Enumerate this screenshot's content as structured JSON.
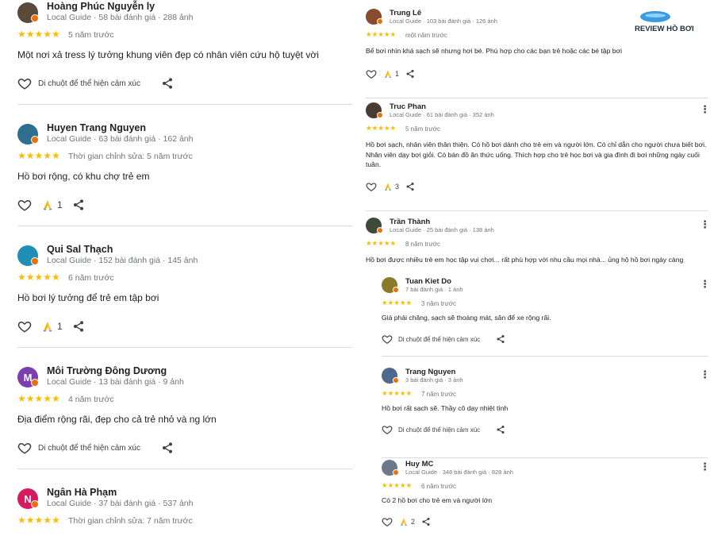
{
  "left_reviews": [
    {
      "name": "Hoàng Phúc Nguyễn ly",
      "meta": "Local Guide · 58 bài đánh giá · 288 ảnh",
      "stars": "★★★★★",
      "when": "5 năm trước",
      "text": "Một nơi xả tress lý tưởng khung viên đẹp có nhân viên cứu hộ tuyệt vời",
      "reactions": "",
      "hint": "Di chuột để thể hiện cảm xúc",
      "avatar_color": "#5a4a3a",
      "avatar_letter": ""
    },
    {
      "name": "Huyen Trang Nguyen",
      "meta": "Local Guide · 63 bài đánh giá · 162 ảnh",
      "stars": "★★★★★",
      "when": "Thời gian chỉnh sửa: 5 năm trước",
      "text": "Hồ bơi rộng, có khu chợ trẻ em",
      "reactions": "1",
      "hint": "",
      "avatar_color": "#2d6f8f",
      "avatar_letter": ""
    },
    {
      "name": "Qui Sal Thạch",
      "meta": "Local Guide · 152 bài đánh giá · 145 ảnh",
      "stars": "★★★★★",
      "when": "6 năm trước",
      "text": "Hồ bơi lý tưởng để trẻ em tập bơi",
      "reactions": "1",
      "hint": "",
      "avatar_color": "#1f8fb5",
      "avatar_letter": ""
    },
    {
      "name": "Môi Trường Đông Dương",
      "meta": "Local Guide · 13 bài đánh giá · 9 ảnh",
      "stars": "★★★★★",
      "when": "4 năm trước",
      "text": "Địa điểm rộng rãi, đẹp cho cả trẻ nhỏ và ng lớn",
      "reactions": "",
      "hint": "Di chuột để thể hiện cảm xúc",
      "avatar_color": "#7b3fb0",
      "avatar_letter": "M"
    },
    {
      "name": "Ngân Hà Phạm",
      "meta": "Local Guide · 37 bài đánh giá · 537 ảnh",
      "stars": "★★★★★",
      "when": "Thời gian chỉnh sửa: 7 năm trước",
      "text": "",
      "reactions": "",
      "hint": "",
      "avatar_color": "#d81b60",
      "avatar_letter": "N"
    }
  ],
  "brand": {
    "text": "REVIEW HỒ BƠI",
    "color": "#3b9be0"
  },
  "right_reviews": [
    {
      "name": "Trung Lê",
      "meta": "Local Guide · 103 bài đánh giá · 126 ảnh",
      "stars": "★★★★★",
      "when": "một năm trước",
      "text": "Bể bơi nhìn khá sạch sẽ nhưng hơi bé. Phù hợp cho các bạn trẻ hoặc các bé tập bơi",
      "reactions": "1",
      "hint": "",
      "avatar_color": "#8a4b2d"
    },
    {
      "name": "Truc Phan",
      "meta": "Local Guide · 61 bài đánh giá · 352 ảnh",
      "stars": "★★★★★",
      "when": "5 năm trước",
      "text": "Hồ bơi sạch, nhân viên thân thiện. Có hồ bơi dành cho trẻ em và người lớn. Có chỉ dẫn cho người chưa biết bơi. Nhân viên dạy bơi giỏi. Có bán đồ ăn thức uống. Thích hợp cho trẻ học bơi và gia đình đi bơi những ngày cuối tuần.",
      "reactions": "3",
      "hint": "",
      "avatar_color": "#4a3c33"
    },
    {
      "name": "Trần Thành",
      "meta": "Local Guide · 25 bài đánh giá · 138 ảnh",
      "stars": "★★★★★",
      "when": "8 năm trước",
      "text": "Hồ bơi được nhiều trẻ em học tập vui chơi... rất phù hợp với nhu cầu mọi nhà... ủng hộ hồ bơi ngày càng",
      "reactions": "",
      "hint": "",
      "avatar_color": "#3d4a3a"
    },
    {
      "name": "Tuan Kiet Do",
      "meta": "7 bài đánh giá · 1 ảnh",
      "stars": "★★★★★",
      "when": "3 năm trước",
      "text": "Giá phải chăng, sạch sẽ thoáng mát, sân để xe rộng rãi.",
      "reactions": "",
      "hint": "Di chuột để thể hiện cảm xúc",
      "avatar_color": "#8a7a2a"
    },
    {
      "name": "Trang Nguyen",
      "meta": "3 bài đánh giá · 3 ảnh",
      "stars": "★★★★★",
      "when": "7 năm trước",
      "text": "Hồ bơi rất sạch sẽ. Thầy cô dạy nhiệt tình",
      "reactions": "",
      "hint": "Di chuột để thể hiện cảm xúc",
      "avatar_color": "#4c6a8c"
    },
    {
      "name": "Huy MC",
      "meta": "Local Guide · 348 bài đánh giá · 828 ảnh",
      "stars": "★★★★★",
      "when": "6 năm trước",
      "text": "Có 2 hồ bơi cho trẻ em và người lớn",
      "reactions": "2",
      "hint": "",
      "avatar_color": "#6a7a88"
    }
  ]
}
